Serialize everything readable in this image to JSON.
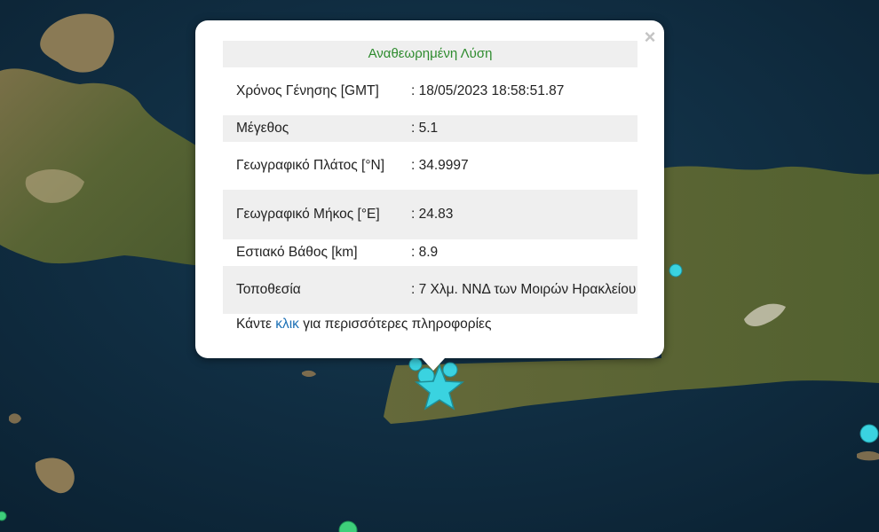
{
  "popup": {
    "title": "Αναθεωρημένη Λύση",
    "close_symbol": "×",
    "rows": [
      {
        "label": "Χρόνος Γένησης [GMT]",
        "value": ": 18/05/2023 18:58:51.87"
      },
      {
        "label": "Μέγεθος",
        "value": ": 5.1"
      },
      {
        "label": "Γεωγραφικό Πλάτος [°N]",
        "value": ": 34.9997"
      },
      {
        "label": "Γεωγραφικό Μήκος [°E]",
        "value": ": 24.83"
      },
      {
        "label": "Εστιακό Βάθος [km]",
        "value": ": 8.9"
      },
      {
        "label": "Τοποθεσία",
        "value": ": 7 Χλμ. ΝΝΔ των Μοιρών Ηρακλείου"
      }
    ],
    "footer": {
      "prefix": "Κάντε ",
      "link": "κλικ",
      "suffix": " για περισσότερες πληροφορίες"
    }
  },
  "colors": {
    "sea": "#0e2a3e",
    "land": "#5e6a3a",
    "marker": "#3ad3e0",
    "title_green": "#2e8b2e",
    "link_blue": "#1a6fb5"
  },
  "icons": {
    "epicenter": "star-icon",
    "events": "circle-icon",
    "close": "close-icon"
  }
}
